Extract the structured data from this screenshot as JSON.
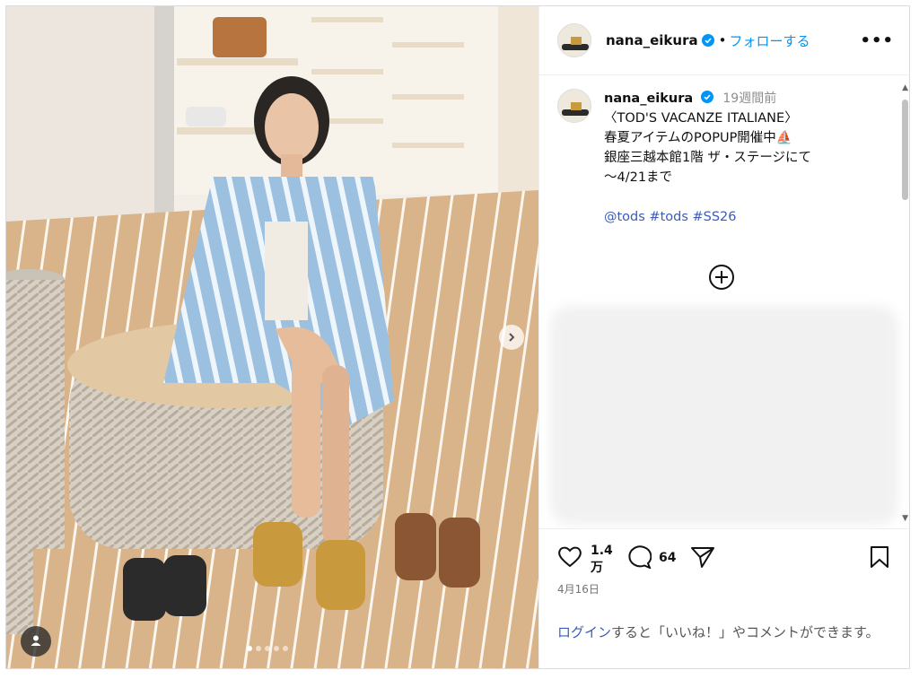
{
  "post": {
    "username": "nana_eikura",
    "follow_label": "フォローする",
    "separator": "•",
    "more_label": "•••"
  },
  "caption": {
    "username": "nana_eikura",
    "time_ago": "19週間前",
    "lines": [
      "〈TOD'S VACANZE ITALIANE〉",
      "春夏アイテムのPOPUP開催中⛵",
      "銀座三越本館1階 ザ・ステージにて",
      "～4/21まで"
    ],
    "tags": "@tods #tods #SS26"
  },
  "stats": {
    "likes_number": "1.4",
    "likes_unit": "万",
    "comments": "64",
    "date": "4月16日"
  },
  "login_prompt": {
    "link": "ログイン",
    "text": "すると「いいね！」やコメントができます。"
  },
  "carousel": {
    "slide_count": 5,
    "active_index": 0
  },
  "icons": {
    "verified": "verified-badge-icon",
    "more": "more-options-icon",
    "add_comment": "plus-circle-icon",
    "like": "heart-icon",
    "comment": "comment-bubble-icon",
    "share": "send-icon",
    "save": "bookmark-icon",
    "next": "chevron-right-icon",
    "user_tag": "person-icon"
  },
  "colors": {
    "verified": "#0095f6",
    "follow": "#0095f6",
    "link": "#3b5cb8",
    "muted": "#8e8e8e"
  }
}
